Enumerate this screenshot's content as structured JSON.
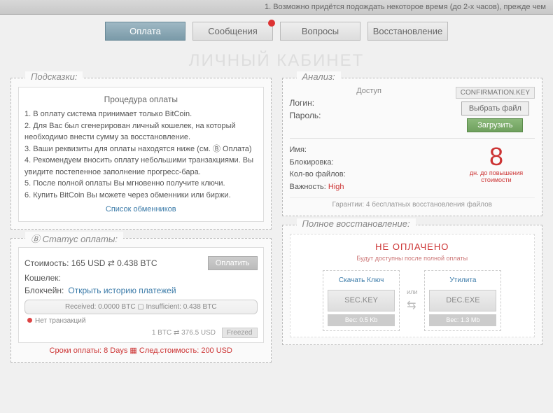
{
  "topbar": "1. Возможно придётся подождать некоторое время (до 2-х часов), прежде чем",
  "tabs": {
    "pay": "Оплата",
    "msg": "Сообщения",
    "q": "Вопросы",
    "rec": "Восстановление"
  },
  "pageTitle": "ЛИЧНЫЙ КАБИНЕТ",
  "hints": {
    "title": "Подсказки:",
    "heading": "Процедура оплаты",
    "l1": "1. В оплату система принимает только BitCoin.",
    "l2": "2. Для Вас был сгенерирован личный кошелек, на который необходимо внести сумму за восстановление.",
    "l3": "3. Ваши реквизиты для оплаты находятся ниже (см. Ⓑ Оплата)",
    "l4": "4. Рекомендуем вносить оплату небольшими транзакциями. Вы увидите постепенное заполнение прогресс-бара.",
    "l5": "5. После полной оплаты Вы мгновенно получите ключи.",
    "l6": "6. Купить BitCoin Вы можете через обменники или биржи.",
    "link": "Список обменников"
  },
  "analysis": {
    "title": "Анализ:",
    "access": "Доступ",
    "login": "Логин:",
    "password": "Пароль:",
    "confirm": "CONFIRMATION.KEY",
    "choose": "Выбрать файл",
    "upload": "Загрузить",
    "name": "Имя:",
    "block": "Блокировка:",
    "files": "Кол-во файлов:",
    "importance": "Важность:",
    "importanceVal": "High",
    "days": "8",
    "daysLabel": "дн. до повышения стоимости",
    "guarantee": "Гарантии: 4 бесплатных восстановления файлов"
  },
  "status": {
    "title": "Ⓑ Статус оплаты:",
    "cost": "Стоимость: 165 USD ⇄ 0.438 BTC",
    "payBtn": "Оплатить",
    "wallet": "Кошелек:",
    "chain": "Блокчейн:",
    "chainLink": "Открыть историю платежей",
    "progress": "Received: 0.0000 BTC ▢ Insufficient: 0.438 BTC",
    "noTx": "Нет транзакций",
    "rate": "1 BTC ⇄ 376.5 USD",
    "freeze": "Freezed",
    "deadline": "Сроки оплаты: 8 Days ▦ След.стоимость: 200 USD"
  },
  "restore": {
    "title": "Полное восстановление:",
    "h1": "НЕ ОПЛАЧЕНО",
    "h2": "Будут доступны после полной оплаты",
    "keyLbl": "Скачать Ключ",
    "keyFile": "SEC.KEY",
    "keySize": "Вес: 0.5 Kb",
    "or": "или",
    "utilLbl": "Утилита",
    "utilFile": "DEC.EXE",
    "utilSize": "Вес: 1.3 Mb"
  }
}
